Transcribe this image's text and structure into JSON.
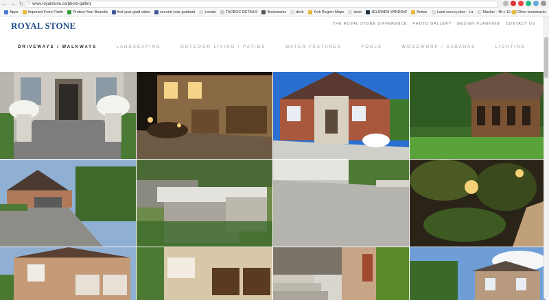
{
  "browser": {
    "url": "www.royalstone.ca/photo-gallery",
    "bookmarks": [
      "Apps",
      "Imported From Firefo",
      "Protect Your Bounda",
      "first year grad video",
      "second year graduati",
      "Locate",
      "TACBOC DETAILS",
      "Bookmarks",
      "deck",
      "York Region Maps",
      "deck",
      "JELDWEN WINDOW",
      "Anime",
      "Land survey plan - La",
      "Maxlav - 48 x 12 x 3",
      "Other bookmarks"
    ]
  },
  "site": {
    "logo": "ROYAL STONE",
    "top_links": [
      "THE ROYAL STONE DIFFERENCE",
      "PHOTO GALLERY",
      "DESIGN PLANNING",
      "CONTACT US"
    ],
    "nav": [
      "DRIVEWAYS / WALKWAYS",
      "LANDSCAPING",
      "OUTDOOR LIVING / PATIOS",
      "WATER FEATURES",
      "POOLS",
      "WOODWORK / CABANAS",
      "LIGHTING"
    ],
    "gallery": [
      {
        "name": "photo-entrance-planters"
      },
      {
        "name": "photo-night-driveway"
      },
      {
        "name": "photo-brick-house-driveway"
      },
      {
        "name": "photo-gazebo-lawn"
      },
      {
        "name": "photo-stone-house-driveway"
      },
      {
        "name": "photo-stone-pillar"
      },
      {
        "name": "photo-paver-closeup"
      },
      {
        "name": "photo-garden-lighting"
      },
      {
        "name": "photo-brick-house-garages"
      },
      {
        "name": "photo-tan-house-garages"
      },
      {
        "name": "photo-stone-steps"
      },
      {
        "name": "photo-large-estate"
      }
    ]
  },
  "colors": {
    "logo": "#1d4a8a",
    "nav_active": "#222222",
    "nav_inactive": "#9a9a9a"
  }
}
